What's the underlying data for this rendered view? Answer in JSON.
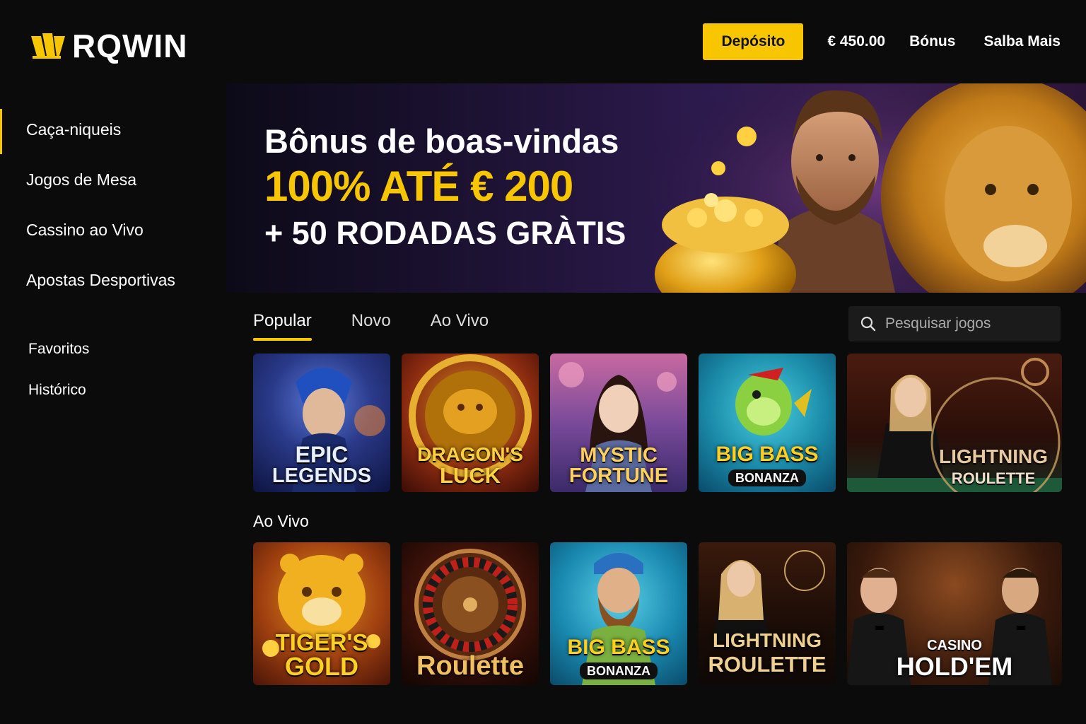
{
  "header": {
    "logo_text": "RQWIN",
    "deposit_label": "Depósito",
    "balance": "€ 450.00",
    "links": [
      "Bónus",
      "Salba Mais"
    ],
    "accent_color": "#f7c600"
  },
  "sidebar": {
    "items": [
      {
        "label": "Caça-niqueis",
        "active": true
      },
      {
        "label": "Jogos de Mesa"
      },
      {
        "label": "Cassino ao Vivo"
      },
      {
        "label": "Apostas Desportivas"
      }
    ],
    "secondary": [
      "Favoritos",
      "Histórico"
    ]
  },
  "banner": {
    "line1": "Bônus de boas-vindas",
    "line2": "100% ATÉ € 200",
    "line3": "+ 50 RODADAS GRÀTIS"
  },
  "tabs": [
    {
      "label": "Popular",
      "active": true
    },
    {
      "label": "Novo"
    },
    {
      "label": "Ao Vivo"
    }
  ],
  "search": {
    "placeholder": "Pesquisar jogos",
    "icon": "search-icon"
  },
  "popular_games": [
    {
      "line1": "EPIC",
      "line2": "LEGENDS"
    },
    {
      "line1": "DRAGON'S",
      "line2": "LUCK"
    },
    {
      "line1": "MYSTIC",
      "line2": "FORTUNE"
    },
    {
      "line1": "BIG BASS",
      "line2": "BONANZA"
    },
    {
      "line1": "LIGHTNING",
      "line2": "ROULETTE"
    }
  ],
  "live_section_title": "Ao Vivo",
  "live_games": [
    {
      "line1": "TIGER'S",
      "line2": "GOLD"
    },
    {
      "line1": "",
      "line2": "Roulette"
    },
    {
      "line1": "BIG BASS",
      "line2": "BONANZA"
    },
    {
      "line1": "LIGHTNING",
      "line2": "ROULETTE"
    },
    {
      "line1": "CASINO",
      "line2": "HOLD'EM"
    }
  ]
}
